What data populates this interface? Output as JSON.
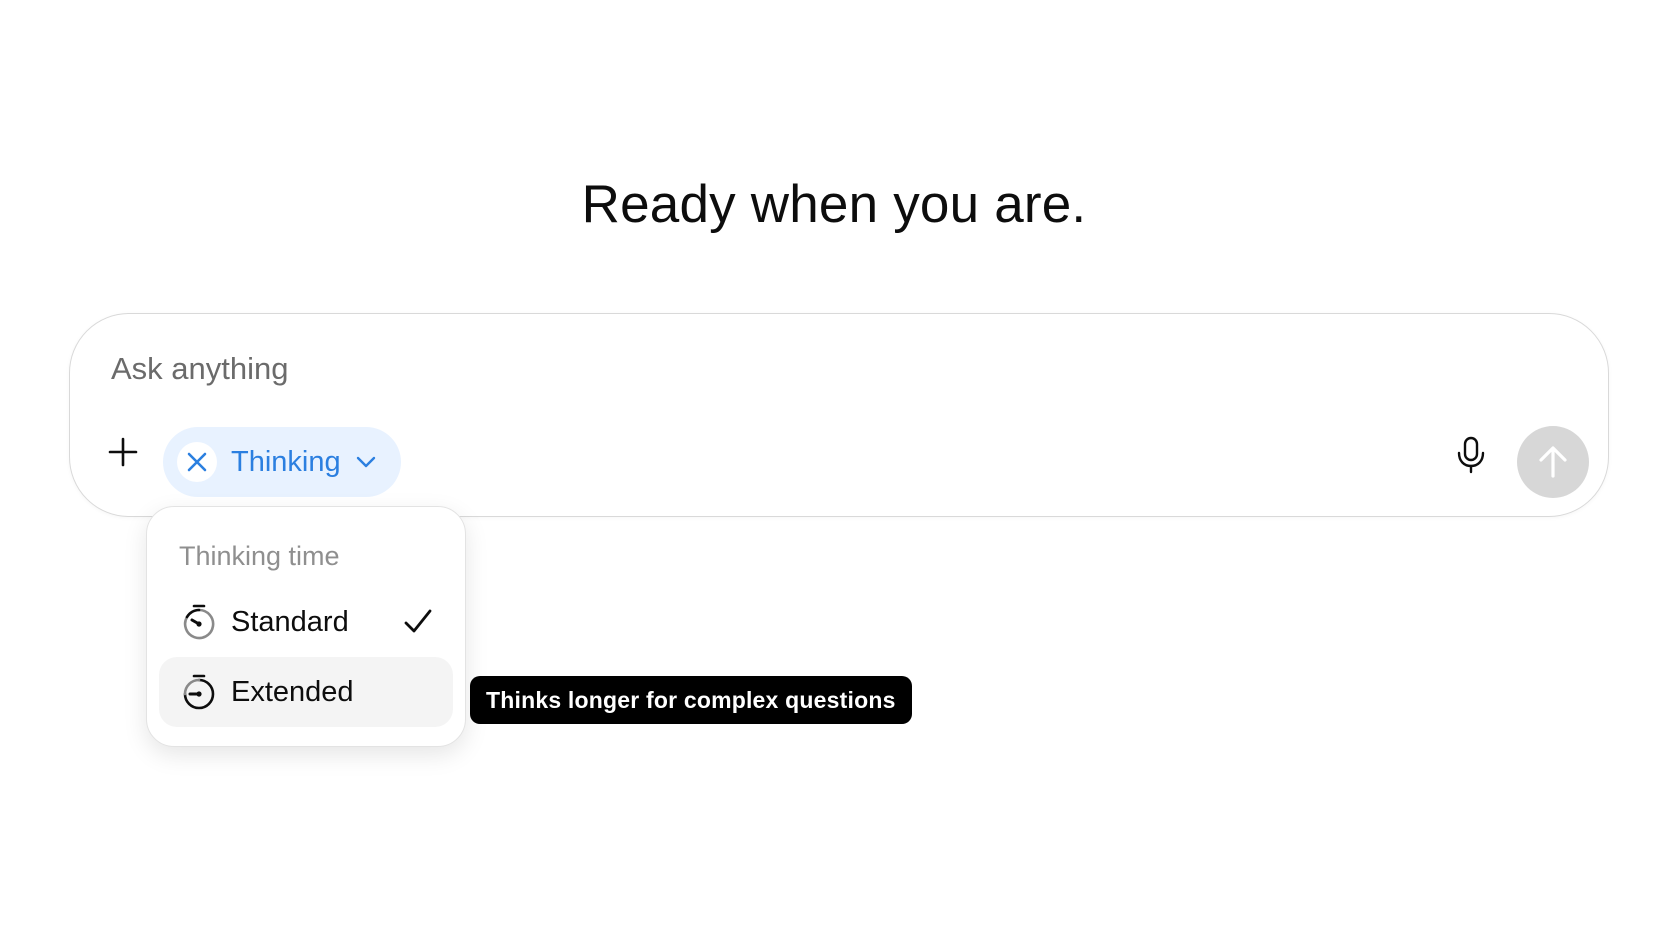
{
  "headline": "Ready when you are.",
  "composer": {
    "placeholder": "Ask anything",
    "value": "",
    "chip": {
      "label": "Thinking"
    }
  },
  "thinking_menu": {
    "title": "Thinking time",
    "items": [
      {
        "label": "Standard",
        "selected": true
      },
      {
        "label": "Extended",
        "selected": false,
        "hovered": true
      }
    ]
  },
  "tooltip": {
    "text": "Thinks longer for complex questions"
  },
  "icons": {
    "attach": "plus-icon",
    "chip_remove": "close-icon",
    "chip_expand": "chevron-down-icon",
    "voice": "microphone-icon",
    "send": "arrow-up-icon",
    "standard": "stopwatch-icon",
    "extended": "stopwatch-icon",
    "selected": "checkmark-icon"
  },
  "colors": {
    "chip_background": "#e8f2ff",
    "chip_text": "#2b7fe0",
    "send_disabled": "#d7d7d7",
    "tooltip_background": "#000000"
  }
}
